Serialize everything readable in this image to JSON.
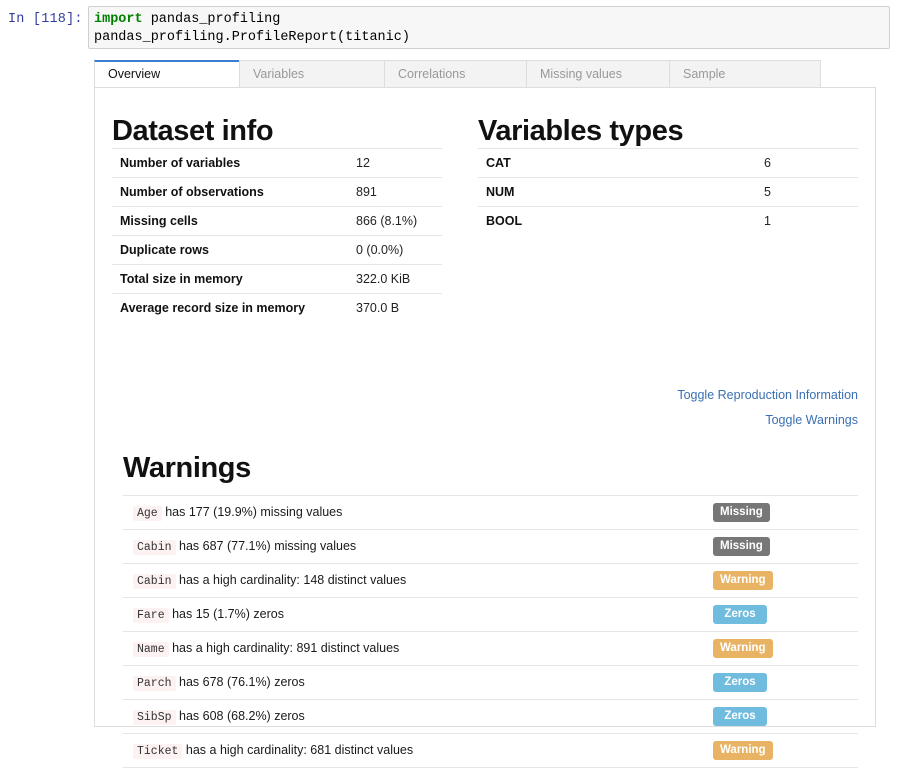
{
  "notebook": {
    "prompt": "In [118]:",
    "code_lines": [
      {
        "keyword": "import",
        "rest": " pandas_profiling"
      },
      {
        "keyword": "",
        "rest": "pandas_profiling.ProfileReport(titanic)"
      }
    ]
  },
  "tabs": [
    {
      "label": "Overview",
      "active": true
    },
    {
      "label": "Variables",
      "active": false
    },
    {
      "label": "Correlations",
      "active": false
    },
    {
      "label": "Missing values",
      "active": false
    },
    {
      "label": "Sample",
      "active": false
    }
  ],
  "dataset_info": {
    "title": "Dataset info",
    "rows": [
      {
        "key": "Number of variables",
        "value": "12"
      },
      {
        "key": "Number of observations",
        "value": "891"
      },
      {
        "key": "Missing cells",
        "value": "866 (8.1%)"
      },
      {
        "key": "Duplicate rows",
        "value": "0 (0.0%)"
      },
      {
        "key": "Total size in memory",
        "value": "322.0 KiB"
      },
      {
        "key": "Average record size in memory",
        "value": "370.0 B"
      }
    ]
  },
  "variables_types": {
    "title": "Variables types",
    "rows": [
      {
        "key": "CAT",
        "value": "6"
      },
      {
        "key": "NUM",
        "value": "5"
      },
      {
        "key": "BOOL",
        "value": "1"
      }
    ]
  },
  "toggles": [
    {
      "label": "Toggle Reproduction Information"
    },
    {
      "label": "Toggle Warnings"
    }
  ],
  "warnings": {
    "title": "Warnings",
    "rows": [
      {
        "variable": "Age",
        "message": "has 177 (19.9%) missing values",
        "badge": "Missing",
        "badge_type": "missing"
      },
      {
        "variable": "Cabin",
        "message": "has 687 (77.1%) missing values",
        "badge": "Missing",
        "badge_type": "missing"
      },
      {
        "variable": "Cabin",
        "message": "has a high cardinality: 148 distinct values",
        "badge": "Warning",
        "badge_type": "warning"
      },
      {
        "variable": "Fare",
        "message": "has 15 (1.7%) zeros",
        "badge": "Zeros",
        "badge_type": "zeros"
      },
      {
        "variable": "Name",
        "message": "has a high cardinality: 891 distinct values",
        "badge": "Warning",
        "badge_type": "warning"
      },
      {
        "variable": "Parch",
        "message": "has 678 (76.1%) zeros",
        "badge": "Zeros",
        "badge_type": "zeros"
      },
      {
        "variable": "SibSp",
        "message": "has 608 (68.2%) zeros",
        "badge": "Zeros",
        "badge_type": "zeros"
      },
      {
        "variable": "Ticket",
        "message": "has a high cardinality: 681 distinct values",
        "badge": "Warning",
        "badge_type": "warning"
      }
    ]
  },
  "colors": {
    "accent_tab": "#3b7fd4",
    "link": "#3a70b2",
    "badge_missing": "#777777",
    "badge_warning": "#e8b464",
    "badge_zeros": "#70bcdf",
    "keyword": "#008000"
  }
}
